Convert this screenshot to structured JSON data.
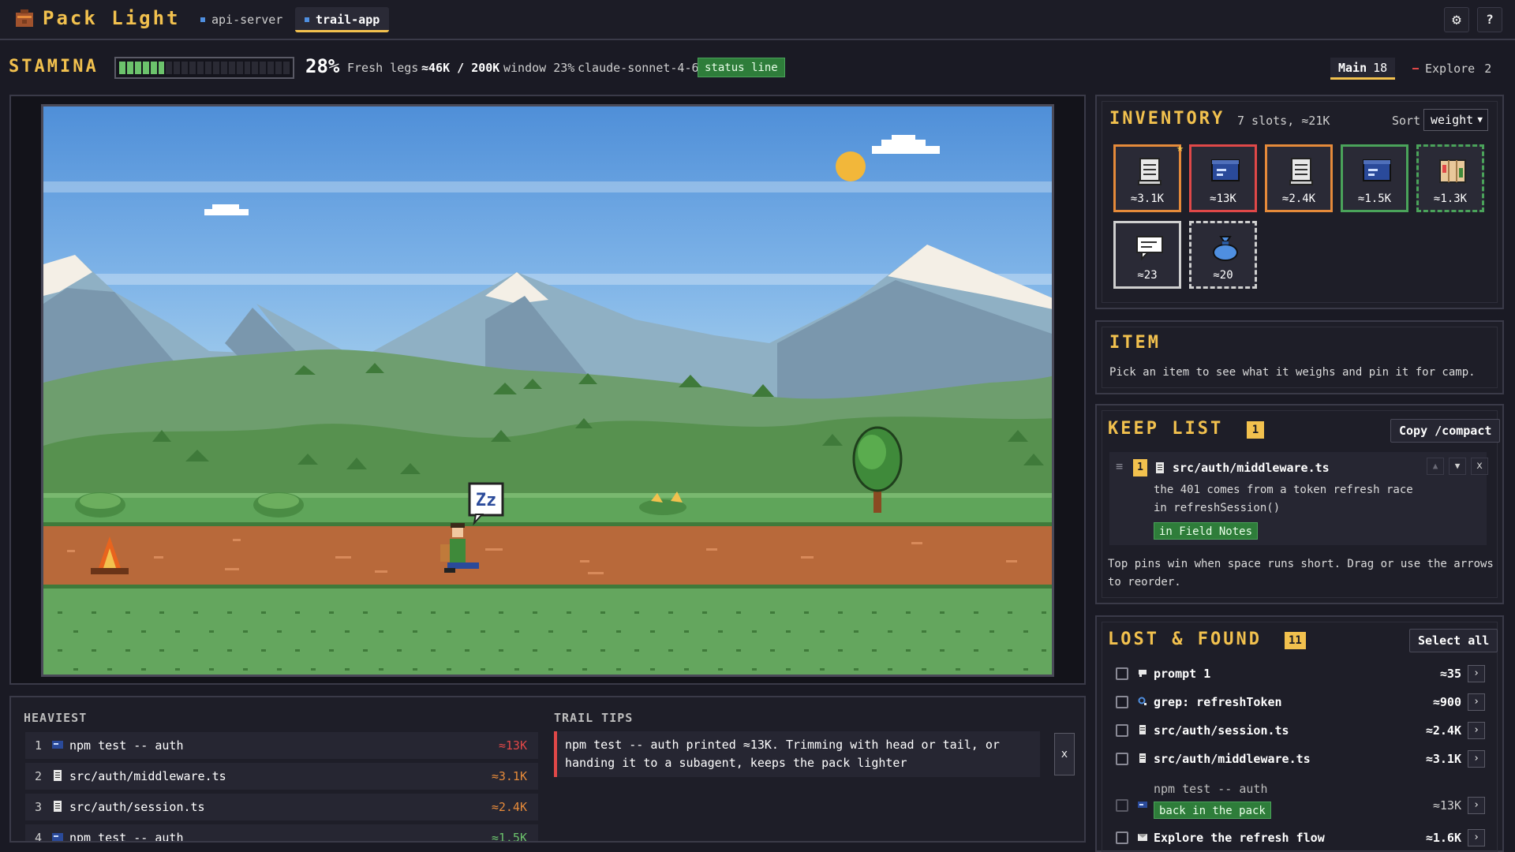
{
  "app": {
    "title": "Pack Light"
  },
  "tabs": [
    {
      "label": "api-server",
      "active": false
    },
    {
      "label": "trail-app",
      "active": true
    }
  ],
  "header": {
    "settings_icon": "gear-icon",
    "help_label": "?"
  },
  "stamina": {
    "label": "STAMINA",
    "level": 0.28,
    "percent": "28%",
    "mood": "Fresh legs",
    "tokens": "≈46K / 200K",
    "window": "window 23%",
    "model": "claude-sonnet-4-6",
    "status_badge": "status line"
  },
  "agents": {
    "main": {
      "label": "Main",
      "count": "18"
    },
    "explore": {
      "label": "Explore",
      "count": "2"
    }
  },
  "heaviest": {
    "title": "HEAVIEST",
    "items": [
      {
        "n": "1",
        "label": "npm test -- auth",
        "size": "≈13K",
        "icon": "terminal-icon"
      },
      {
        "n": "2",
        "label": "src/auth/middleware.ts",
        "size": "≈3.1K",
        "icon": "file-icon"
      },
      {
        "n": "3",
        "label": "src/auth/session.ts",
        "size": "≈2.4K",
        "icon": "file-icon"
      },
      {
        "n": "4",
        "label": "npm test -- auth",
        "size": "≈1.5K",
        "icon": "terminal-icon"
      }
    ]
  },
  "trail_tips": {
    "title": "TRAIL TIPS",
    "text": "npm test -- auth printed ≈13K. Trimming with head or tail, or handing it to a subagent, keeps the pack lighter",
    "close_label": "x"
  },
  "inventory": {
    "title": "INVENTORY",
    "meta": "7 slots, ≈21K",
    "sort_label": "Sort",
    "sort_value": "weight",
    "slots": [
      {
        "size": "≈3.1K",
        "icon": "scroll-icon",
        "border": "#e58a3a",
        "pinned": true
      },
      {
        "size": "≈13K",
        "icon": "terminal-icon",
        "border": "#e04848",
        "pinned": false
      },
      {
        "size": "≈2.4K",
        "icon": "scroll-icon",
        "border": "#e58a3a",
        "pinned": false
      },
      {
        "size": "≈1.5K",
        "icon": "terminal-icon",
        "border": "#4aa35a",
        "pinned": false
      },
      {
        "size": "≈1.3K",
        "icon": "map-icon",
        "border": "#4aa35a",
        "pinned": false
      },
      {
        "size": "≈23",
        "icon": "speech-icon",
        "border": "#cfcfcf",
        "pinned": false
      },
      {
        "size": "≈20",
        "icon": "pouch-icon",
        "border": "#cfcfcf",
        "pinned": false
      }
    ]
  },
  "item_panel": {
    "title": "ITEM",
    "hint": "Pick an item to see what it weighs and pin it for camp."
  },
  "keep_list": {
    "title": "KEEP LIST",
    "count": "1",
    "copy_label": "Copy /compact",
    "entry": {
      "rank": "1",
      "file": "src/auth/middleware.ts",
      "note_line1": "the 401 comes from a token refresh race",
      "note_line2": "in refreshSession()",
      "tag": "in Field Notes"
    },
    "help_line1": "Top pins win when space runs short. Drag or use the arrows",
    "help_line2": "to reorder.",
    "up_label": "▲",
    "down_label": "▼",
    "remove_label": "x"
  },
  "lost_found": {
    "title": "LOST & FOUND",
    "count": "11",
    "select_all_label": "Select all",
    "items": [
      {
        "label": "prompt 1",
        "size": "≈35",
        "icon": "speech-icon"
      },
      {
        "label": "grep: refreshToken",
        "size": "≈900",
        "icon": "search-icon"
      },
      {
        "label": "src/auth/session.ts",
        "size": "≈2.4K",
        "icon": "file-icon"
      },
      {
        "label": "src/auth/middleware.ts",
        "size": "≈3.1K",
        "icon": "file-icon"
      },
      {
        "label": "npm test -- auth",
        "size": "≈13K",
        "icon": "terminal-icon",
        "tag": "back in the pack",
        "dim": true
      },
      {
        "label": "Explore the refresh flow",
        "size": "≈1.6K",
        "icon": "mail-icon"
      }
    ],
    "go_label": "›"
  },
  "scene": {
    "sleep_bubble": "Zz"
  }
}
